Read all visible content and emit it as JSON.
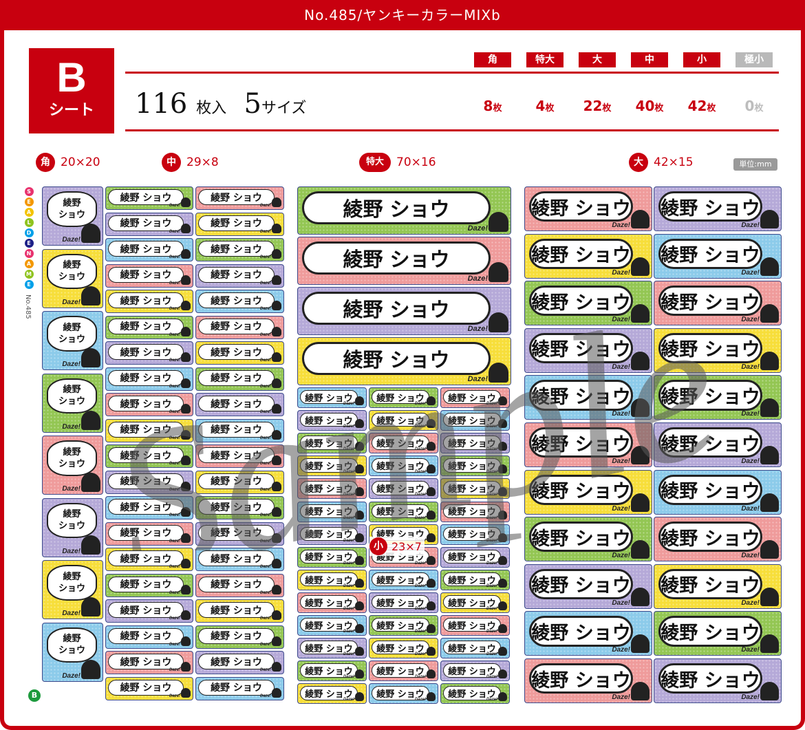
{
  "header": {
    "title": "No.485/ヤンキーカラーMIXb"
  },
  "sheet_badge": {
    "letter": "B",
    "label": "シート"
  },
  "summary": {
    "total": "116",
    "total_unit": "枚入",
    "sizes": "5",
    "sizes_unit": "サイズ"
  },
  "size_columns": [
    {
      "tag": "角",
      "count": "8",
      "unit": "枚",
      "active": true
    },
    {
      "tag": "特大",
      "count": "4",
      "unit": "枚",
      "active": true
    },
    {
      "tag": "大",
      "count": "22",
      "unit": "枚",
      "active": true
    },
    {
      "tag": "中",
      "count": "40",
      "unit": "枚",
      "active": true
    },
    {
      "tag": "小",
      "count": "42",
      "unit": "枚",
      "active": true
    },
    {
      "tag": "極小",
      "count": "0",
      "unit": "枚",
      "active": false
    }
  ],
  "dimension_labels": [
    {
      "tag": "角",
      "size": "20×20"
    },
    {
      "tag": "中",
      "size": "29×8"
    },
    {
      "tag": "特大",
      "size": "70×16"
    },
    {
      "tag": "大",
      "size": "42×15"
    }
  ],
  "small_label": {
    "tag": "小",
    "size": "23×7"
  },
  "unit_note": "単位:mm",
  "brand": {
    "letters": [
      "S",
      "E",
      "A",
      "L",
      "D",
      "E",
      "N",
      "A",
      "M",
      "E"
    ],
    "number": "No.485",
    "corner_mark": "B"
  },
  "sticker": {
    "name": "綾野 ショウ",
    "name_line1": "綾野",
    "name_line2": "ショウ",
    "tagline": "Daze!"
  },
  "watermark": "Sample",
  "colors": {
    "accent": "#c8000f",
    "sticker_palette": [
      "#b5a9d8",
      "#f7de3a",
      "#8ccbea",
      "#93c653",
      "#ef9b9b"
    ]
  }
}
